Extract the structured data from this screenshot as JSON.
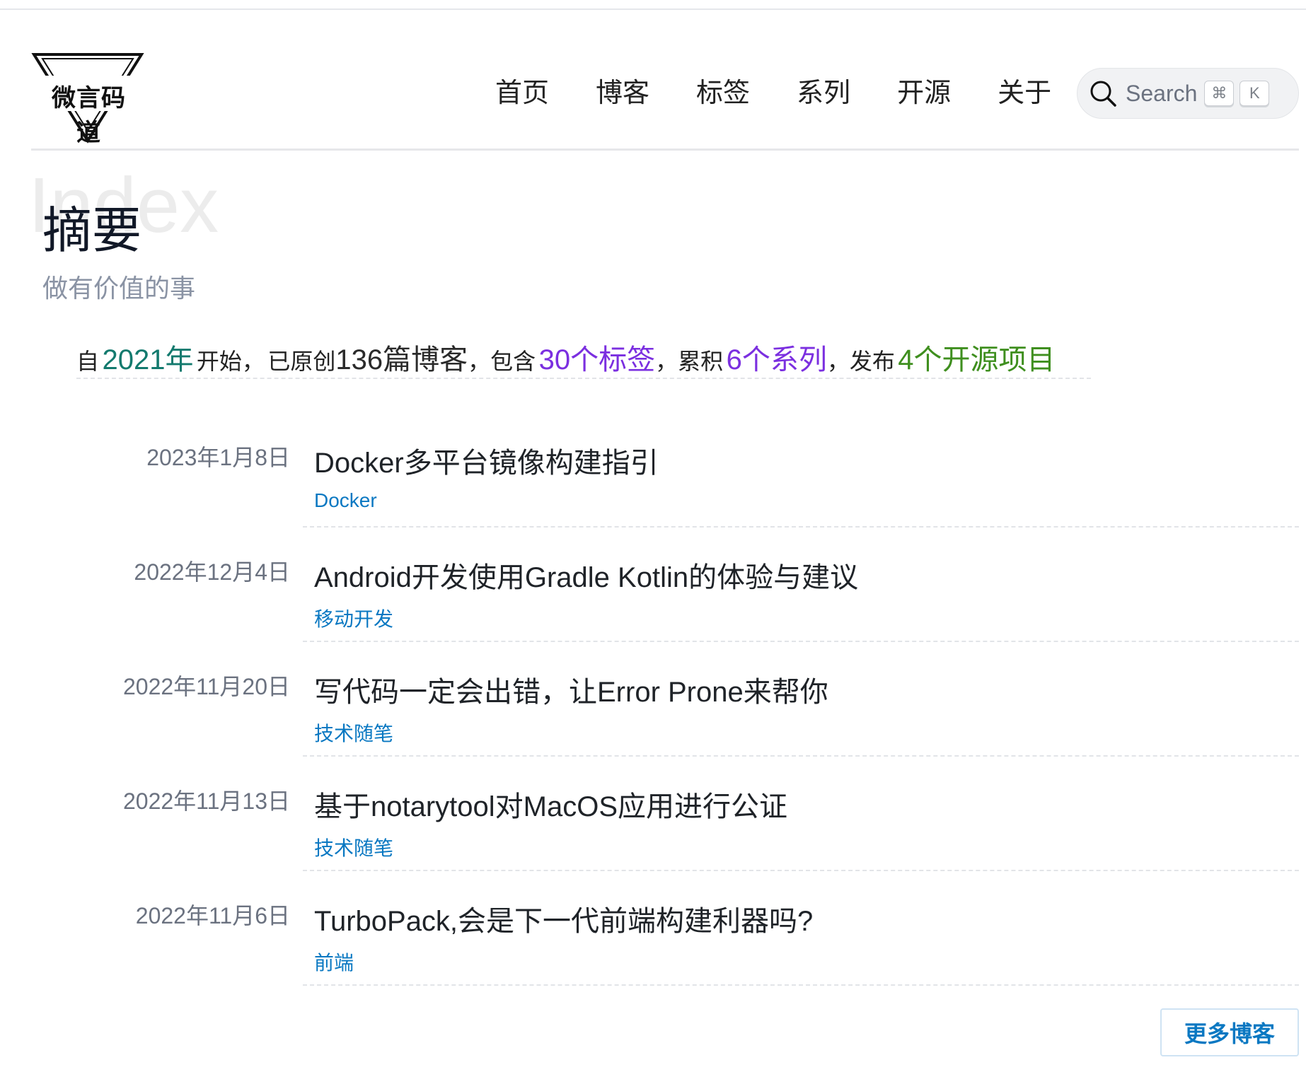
{
  "header": {
    "logo_text": "微言码道",
    "nav": [
      "首页",
      "博客",
      "标签",
      "系列",
      "开源",
      "关于"
    ],
    "search": {
      "label": "Search",
      "keys": [
        "⌘",
        "K"
      ]
    }
  },
  "summary": {
    "bg_word": "Index",
    "title": "摘要",
    "subtitle": "做有价值的事",
    "stats": {
      "p1": "自",
      "year": "2021年",
      "p2": "开始，",
      "p3": "已原创",
      "posts": "136篇博客",
      "p4": "，包含",
      "tags": "30个标签",
      "p5": "，累积",
      "series": "6个系列",
      "p6": "，发布",
      "projects": "4个开源项目"
    }
  },
  "posts": [
    {
      "date": "2023年1月8日",
      "title": "Docker多平台镜像构建指引",
      "tag": "Docker"
    },
    {
      "date": "2022年12月4日",
      "title": "Android开发使用Gradle Kotlin的体验与建议",
      "tag": "移动开发"
    },
    {
      "date": "2022年11月20日",
      "title": "写代码一定会出错，让Error Prone来帮你",
      "tag": "技术随笔"
    },
    {
      "date": "2022年11月13日",
      "title": "基于notarytool对MacOS应用进行公证",
      "tag": "技术随笔"
    },
    {
      "date": "2022年11月6日",
      "title": "TurboPack,会是下一代前端构建利器吗?",
      "tag": "前端"
    }
  ],
  "more_button": "更多博客"
}
